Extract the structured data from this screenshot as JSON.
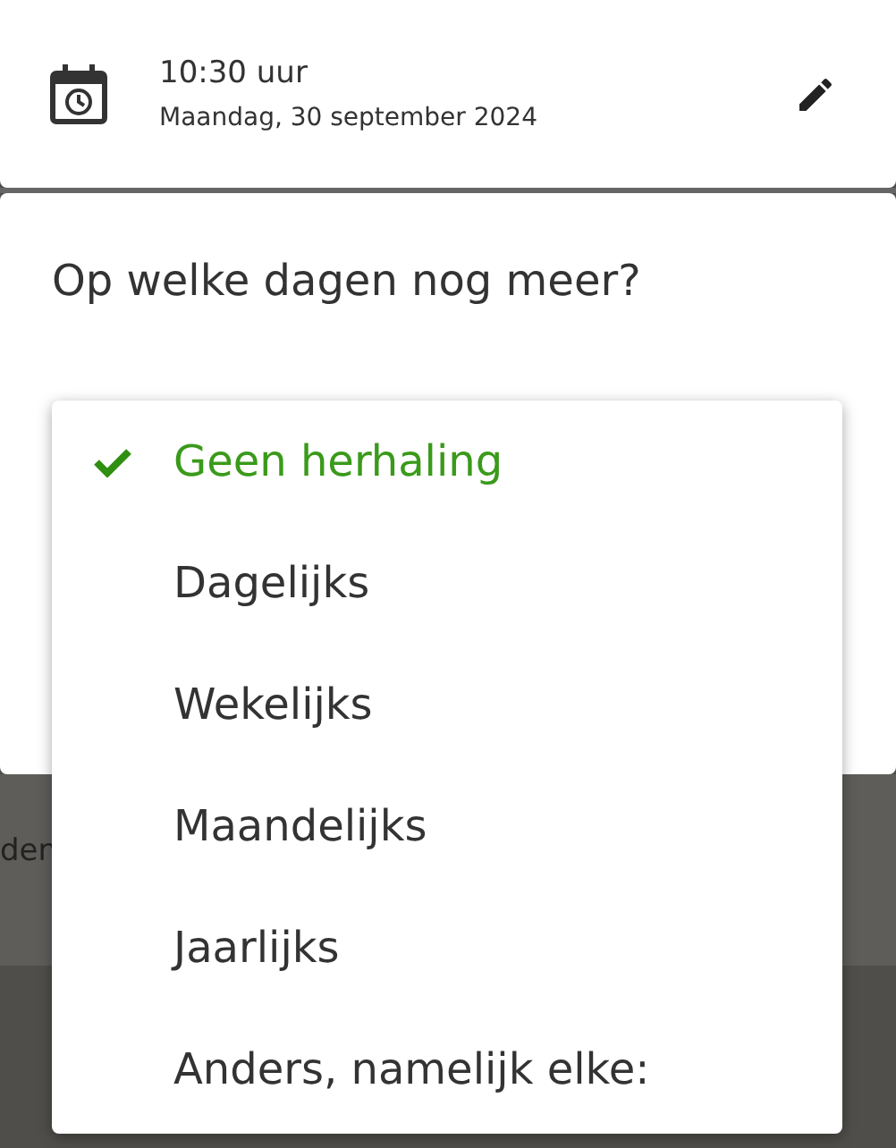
{
  "appointment": {
    "time": "10:30 uur",
    "date": "Maandag, 30 september 2024"
  },
  "question": "Op welke dagen nog meer?",
  "background_text": "den",
  "repeat_menu": [
    {
      "label": "Geen herhaling",
      "selected": true
    },
    {
      "label": "Dagelijks",
      "selected": false
    },
    {
      "label": "Wekelijks",
      "selected": false
    },
    {
      "label": "Maandelijks",
      "selected": false
    },
    {
      "label": "Jaarlijks",
      "selected": false
    },
    {
      "label": "Anders, namelijk elke:",
      "selected": false
    }
  ]
}
